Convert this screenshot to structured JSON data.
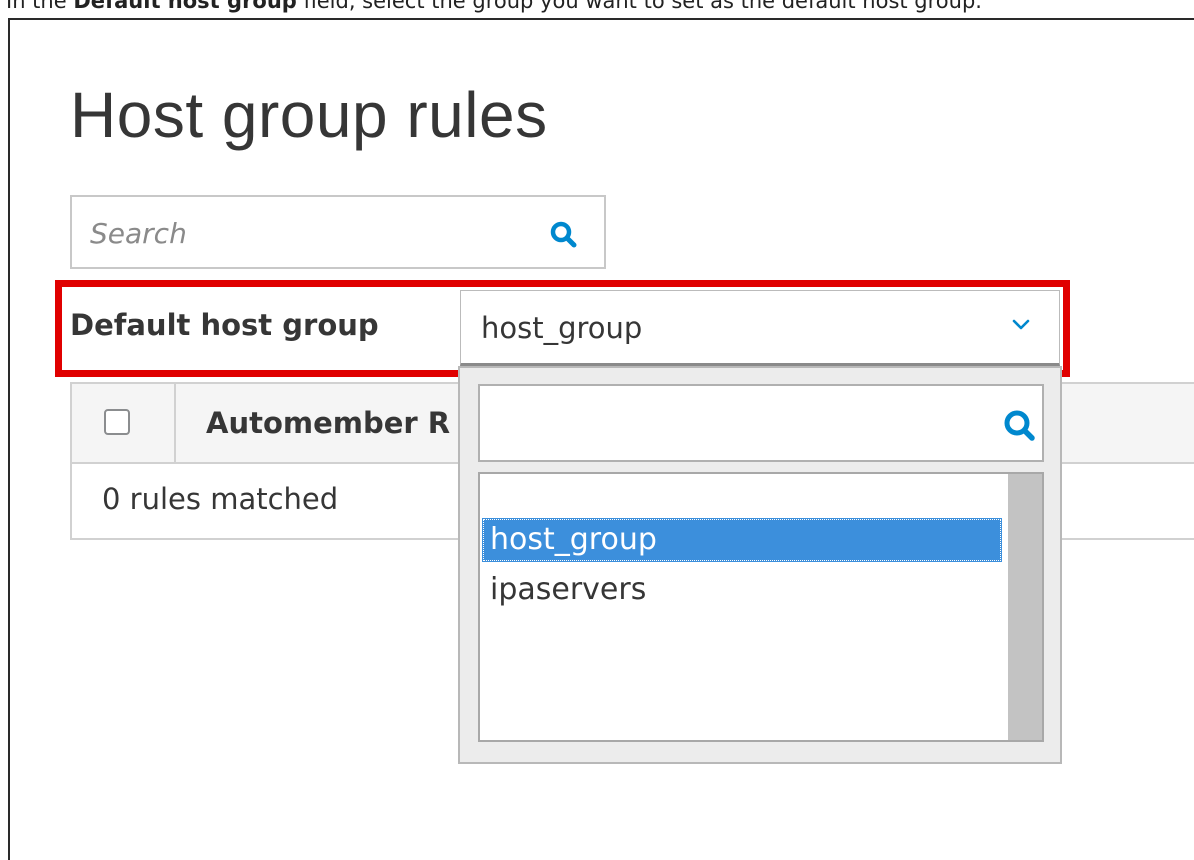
{
  "instruction": {
    "prefix": "In the ",
    "field_name": "Default host group",
    "suffix": " field, select the group you want to set as the default host group."
  },
  "page": {
    "title": "Host group rules"
  },
  "search": {
    "placeholder": "Search",
    "icon": "search-icon"
  },
  "default_host_group": {
    "label": "Default host group",
    "selected_value": "host_group",
    "icon": "chevron-down-icon"
  },
  "table": {
    "select_all_icon": "checkbox",
    "column_header": "Automember R",
    "status": "0 rules matched"
  },
  "dropdown": {
    "filter_value": "",
    "icon": "search-icon",
    "options": [
      {
        "label": "host_group",
        "selected": true
      },
      {
        "label": "ipaservers",
        "selected": false
      }
    ]
  },
  "colors": {
    "accent": "#0088ce",
    "selection": "#3c8fdc",
    "highlight_border": "#e00000"
  }
}
